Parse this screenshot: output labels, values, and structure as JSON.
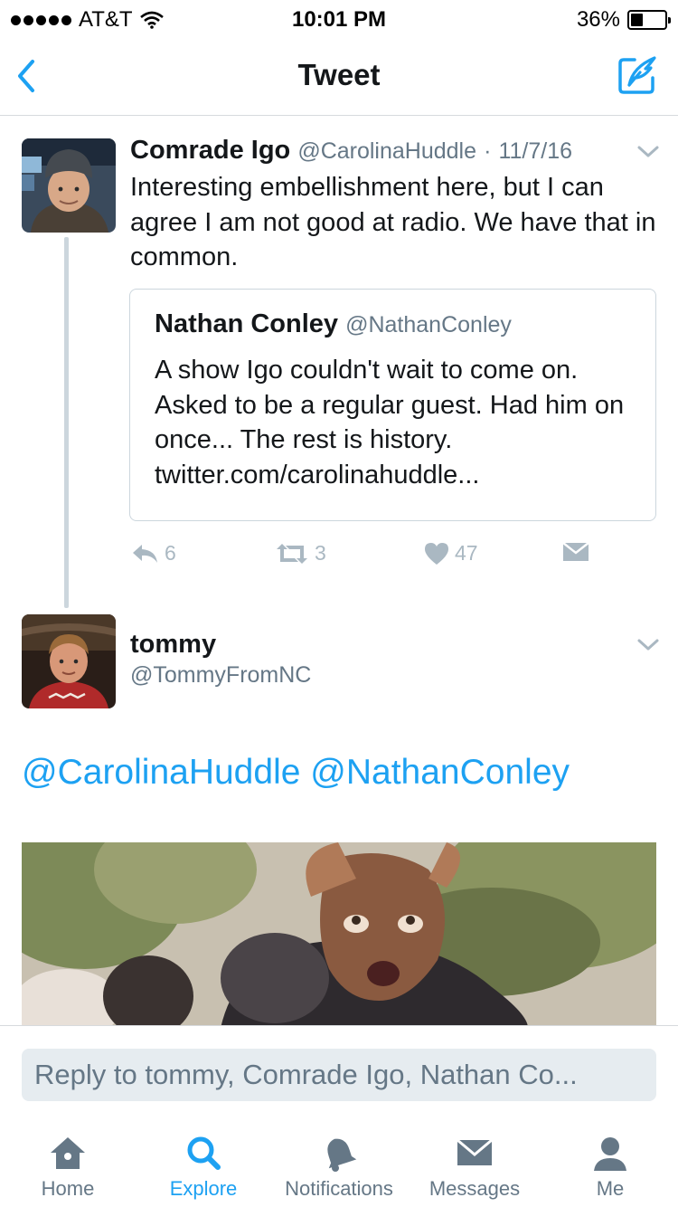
{
  "status_bar": {
    "carrier": "AT&T",
    "time": "10:01 PM",
    "battery": "36%",
    "battery_level": 0.36
  },
  "nav": {
    "title": "Tweet",
    "back_icon": "chevron-left-icon",
    "compose_icon": "compose-quill-icon"
  },
  "tweet1": {
    "name": "Comrade Igo",
    "handle": "@CarolinaHuddle",
    "separator": "·",
    "date": "11/7/16",
    "text": "Interesting embellishment here, but I can agree I am not good at radio. We have that in common.",
    "quote": {
      "name": "Nathan Conley",
      "handle": "@NathanConley",
      "text": "A show Igo couldn't wait to come on. Asked to be a regular guest. Had him on once... The rest is history. twitter.com/carolinahuddle..."
    },
    "actions": {
      "replies": "6",
      "retweets": "3",
      "likes": "47"
    }
  },
  "tweet2": {
    "name": "tommy",
    "handle": "@TommyFromNC",
    "mention1": "@CarolinaHuddle",
    "mention2": "@NathanConley"
  },
  "reply": {
    "placeholder": "Reply to tommy, Comrade Igo, Nathan Co..."
  },
  "tabs": [
    {
      "label": "Home",
      "icon": "home-icon"
    },
    {
      "label": "Explore",
      "icon": "search-icon"
    },
    {
      "label": "Notifications",
      "icon": "bell-icon"
    },
    {
      "label": "Messages",
      "icon": "envelope-icon"
    },
    {
      "label": "Me",
      "icon": "person-icon"
    }
  ],
  "colors": {
    "accent": "#1da1f2",
    "secondary_text": "#657786",
    "action_gray": "#aab8c2",
    "border": "#ccd6dd"
  }
}
